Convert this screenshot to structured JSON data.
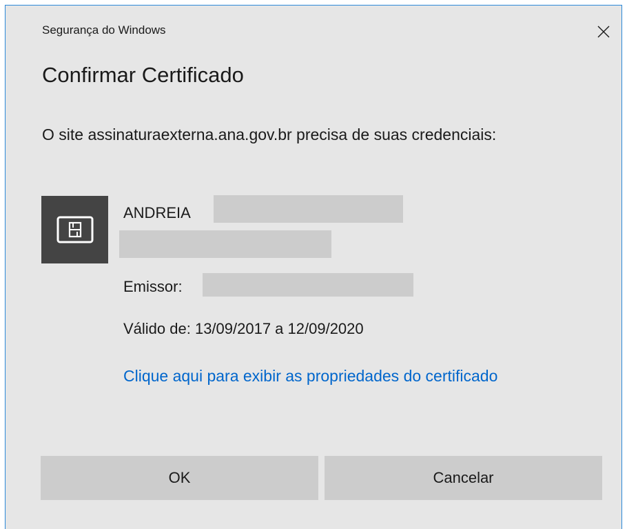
{
  "dialog": {
    "window_title": "Segurança do Windows",
    "close_icon": "close-icon",
    "heading": "Confirmar Certificado",
    "message": "O site assinaturaexterna.ana.gov.br precisa de suas credenciais:"
  },
  "certificate": {
    "icon": "smartcard-icon",
    "name": "ANDREIA",
    "issuer_label": "Emissor:",
    "validity": "Válido de: 13/09/2017 a 12/09/2020",
    "properties_link": "Clique aqui para exibir as propriedades do certificado"
  },
  "buttons": {
    "ok": "OK",
    "cancel": "Cancelar"
  },
  "colors": {
    "background": "#e6e6e6",
    "accent_border": "#2b88d8",
    "link": "#0066cc",
    "icon_tile": "#444444",
    "button": "#cccccc",
    "redaction": "#cccccc"
  }
}
